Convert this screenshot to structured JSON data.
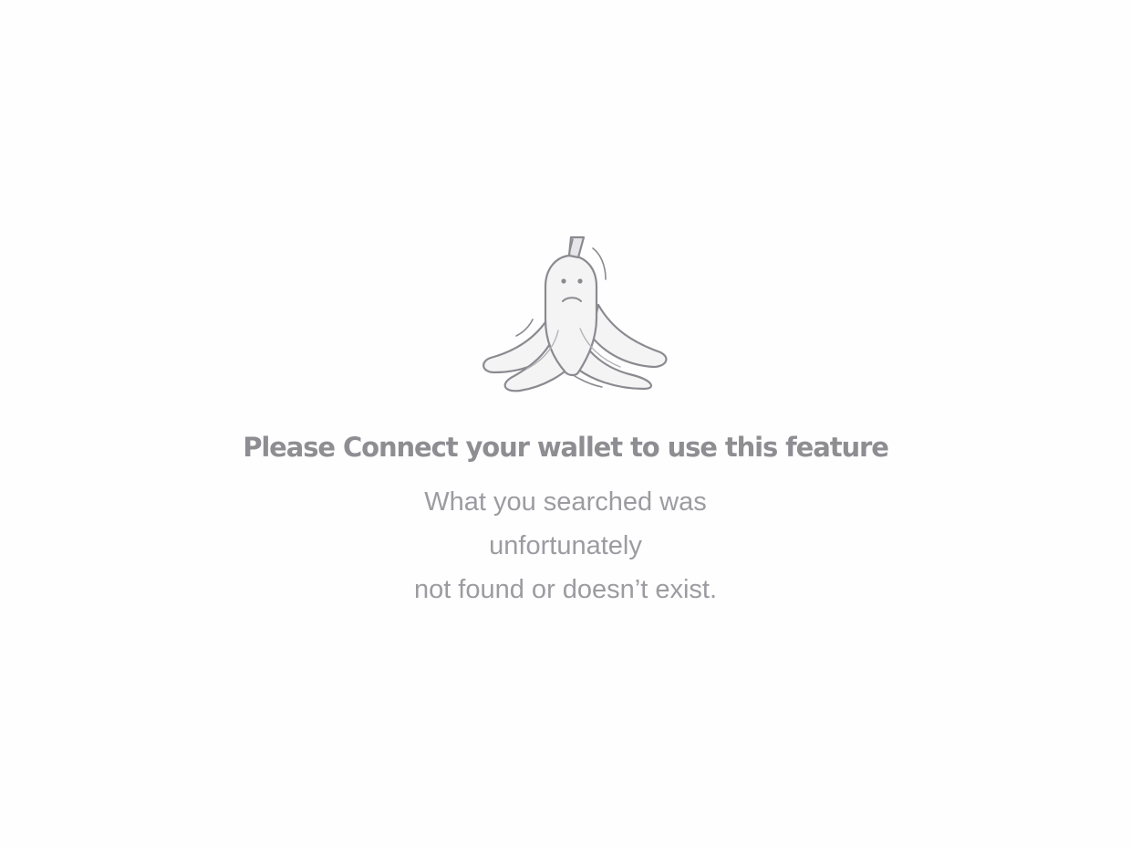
{
  "empty_state": {
    "illustration_icon": "banana-peel-sad-icon",
    "title": "Please Connect your wallet to use this feature",
    "message_lines": [
      "What you searched was",
      "unfortunately",
      "not found or doesn’t exist."
    ]
  },
  "colors": {
    "background": "#fefefe",
    "title": "#8e8d92",
    "message": "#9c9ba1",
    "illustration_stroke": "#8b8a90",
    "illustration_fill": "#f3f3f4"
  }
}
